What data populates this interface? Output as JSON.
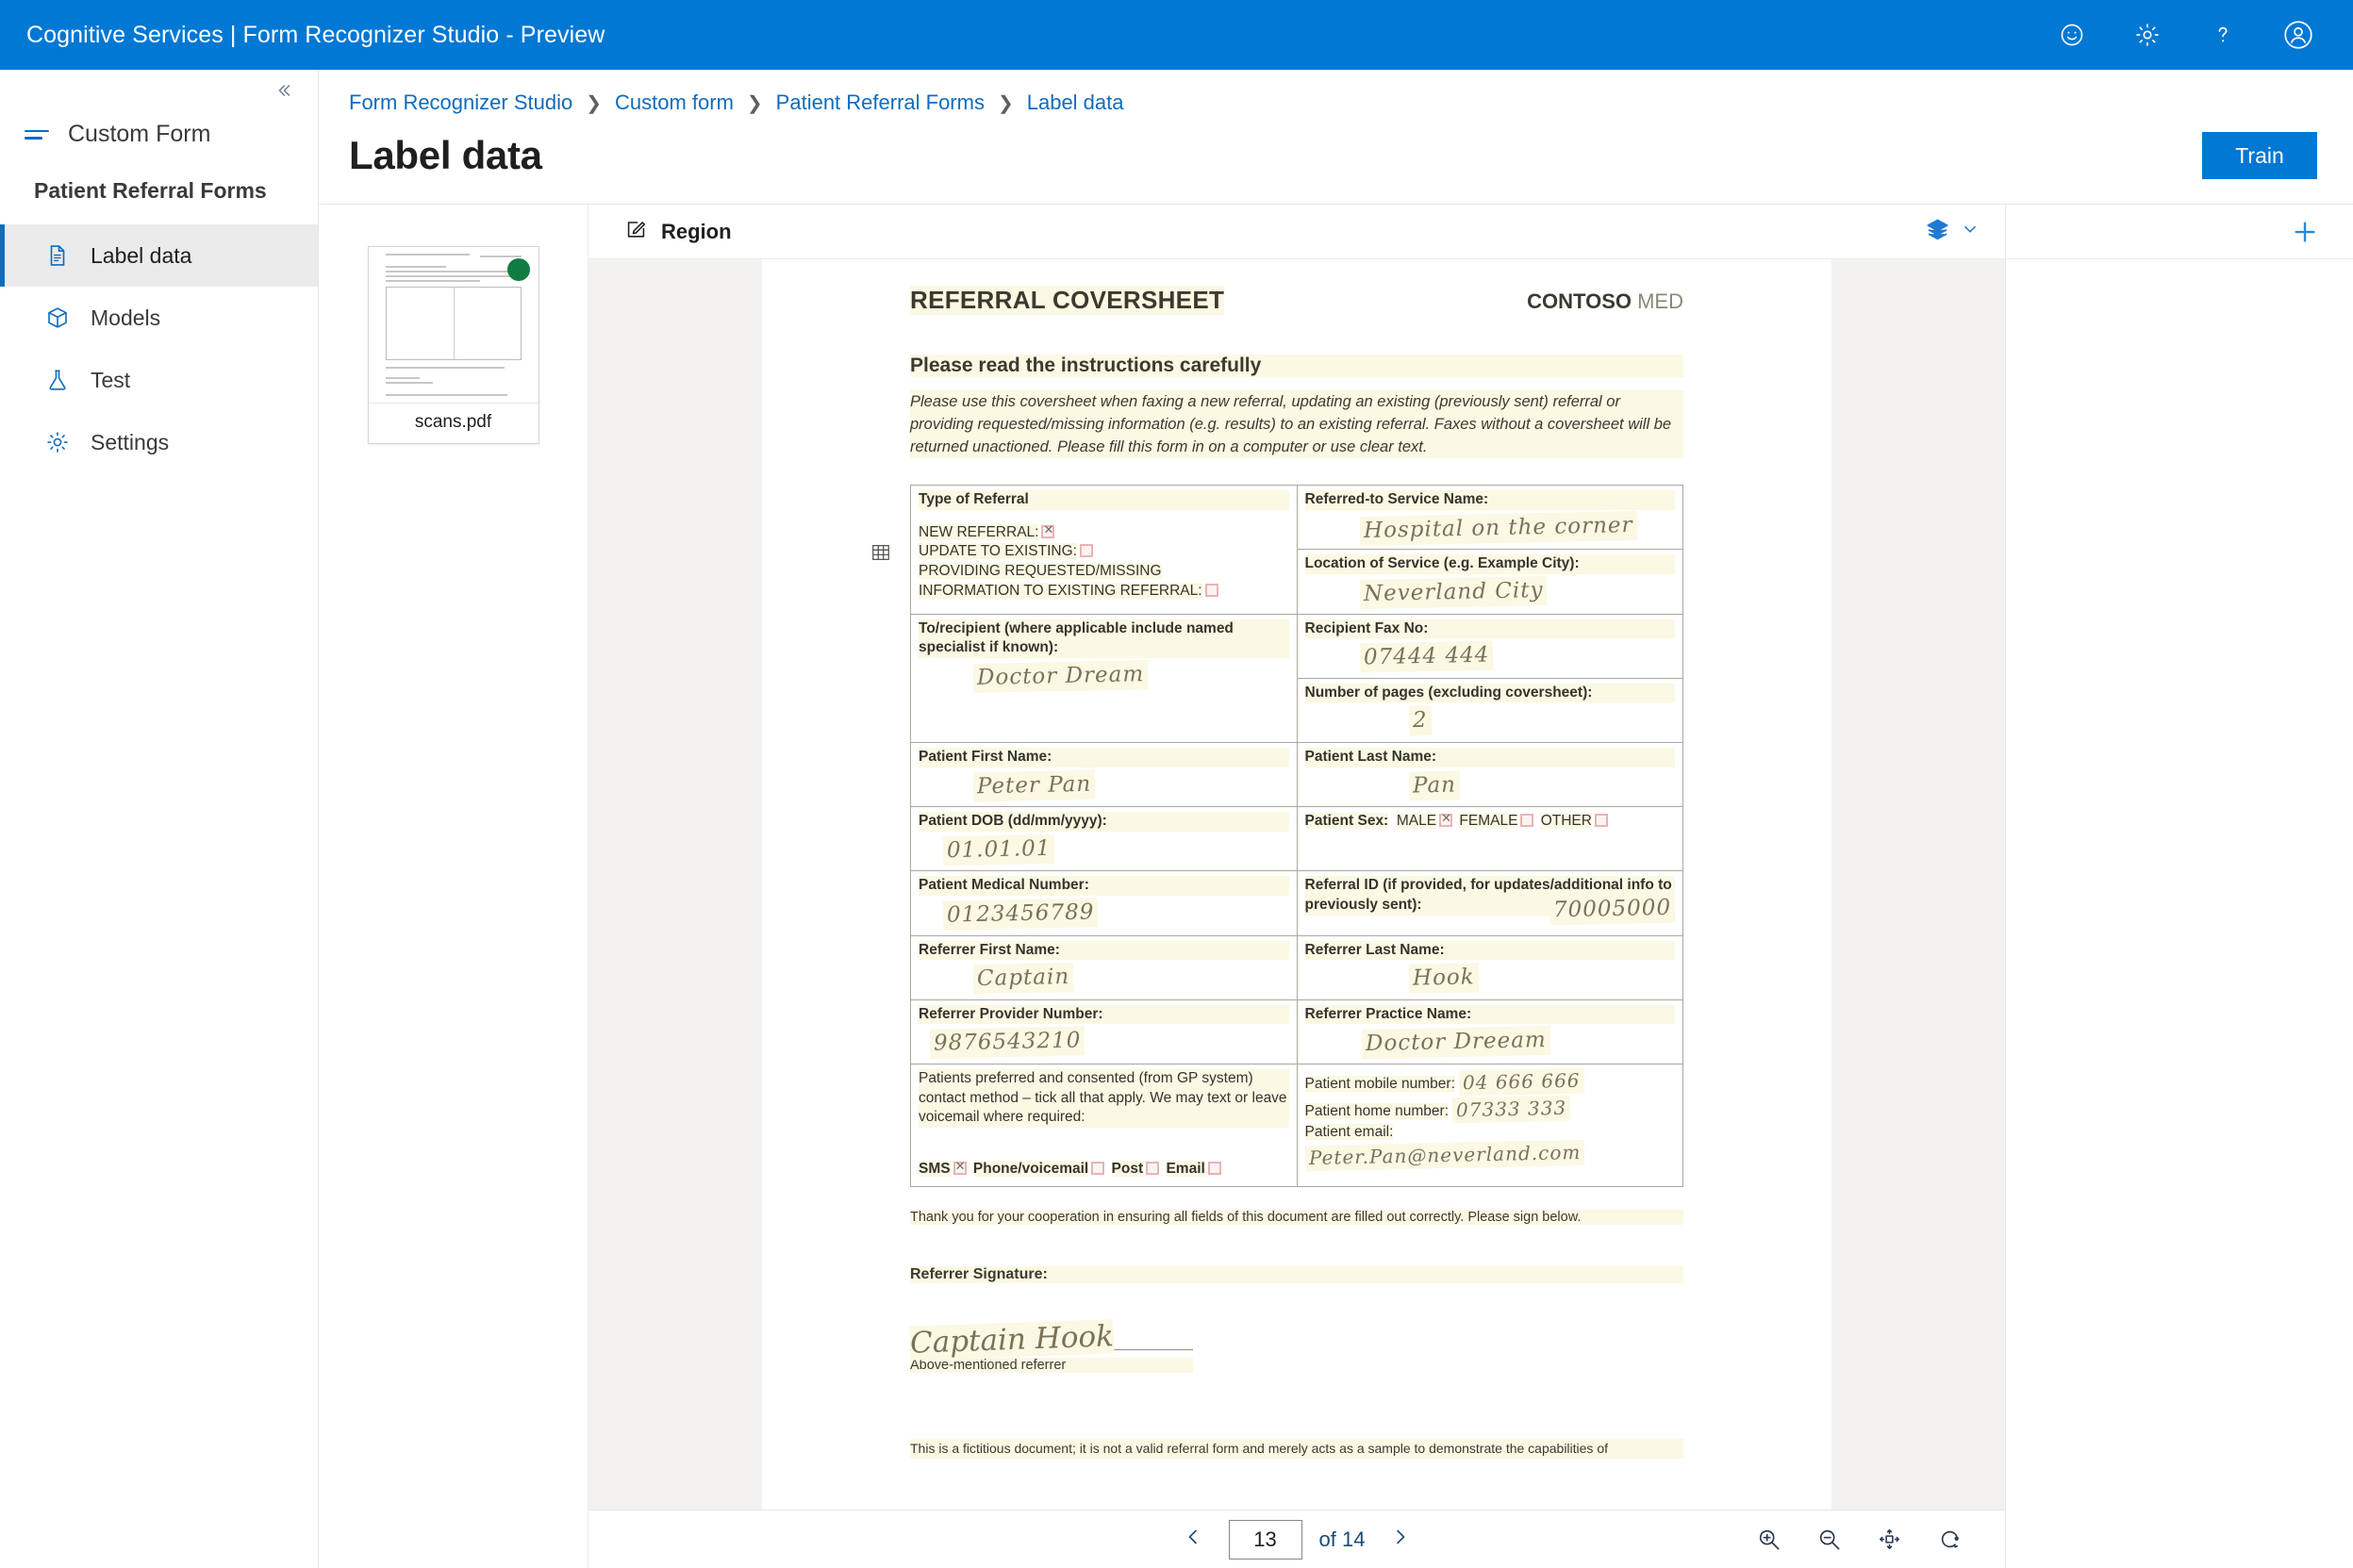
{
  "topbar": {
    "title": "Cognitive Services | Form Recognizer Studio - Preview",
    "icons": [
      {
        "name": "feedback-smiley-icon",
        "label": "Feedback"
      },
      {
        "name": "settings-gear-icon",
        "label": "Settings"
      },
      {
        "name": "help-question-icon",
        "label": "Help"
      },
      {
        "name": "account-avatar-icon",
        "label": "Account"
      }
    ]
  },
  "sidebar": {
    "collapse_label": "«",
    "menu_label": "Custom Form",
    "project_title": "Patient Referral Forms",
    "items": [
      {
        "label": "Label data",
        "icon": "document-icon",
        "active": true
      },
      {
        "label": "Models",
        "icon": "cube-icon",
        "active": false
      },
      {
        "label": "Test",
        "icon": "flask-icon",
        "active": false
      },
      {
        "label": "Settings",
        "icon": "gear-icon",
        "active": false
      }
    ]
  },
  "breadcrumb": [
    {
      "label": "Form Recognizer Studio"
    },
    {
      "label": "Custom form"
    },
    {
      "label": "Patient Referral Forms"
    },
    {
      "label": "Label data"
    }
  ],
  "header": {
    "page_title": "Label data",
    "train_label": "Train"
  },
  "thumbnails": [
    {
      "name": "scans.pdf",
      "status_color": "#107C41"
    }
  ],
  "viewer": {
    "tool_label": "Region",
    "tool_icon": "draw-region-icon",
    "layers_icon": "layers-icon",
    "chevron_icon": "chevron-down-icon",
    "page_value": "13",
    "page_total": "of 14",
    "prev_icon": "chevron-left-icon",
    "next_icon": "chevron-right-icon",
    "zoom_tools": [
      {
        "name": "zoom-in-icon"
      },
      {
        "name": "zoom-out-icon"
      },
      {
        "name": "fit-to-screen-icon"
      },
      {
        "name": "rotate-icon"
      }
    ]
  },
  "label_pane": {
    "add_icon": "plus-icon"
  },
  "document": {
    "title": "REFERRAL COVERSHEET",
    "brand_bold": "CONTOSO",
    "brand_light": "MED",
    "subtitle": "Please read the instructions carefully",
    "intro": "Please use this coversheet when faxing a new referral, updating an existing (previously sent) referral or providing requested/missing information (e.g. results) to an existing referral. Faxes without a coversheet will be returned unactioned. Please fill this form in on a computer or use clear text.",
    "rows": [
      {
        "left_label": "Type of Referral",
        "left_options": [
          {
            "text": "NEW REFERRAL:",
            "checked": true
          },
          {
            "text": "UPDATE TO EXISTING:",
            "checked": false
          },
          {
            "text": "PROVIDING REQUESTED/MISSING",
            "checked": null
          },
          {
            "text": "INFORMATION TO EXISTING REFERRAL:",
            "checked": false
          }
        ],
        "right_label": "Referred-to Service Name:",
        "right_value": "Hospital on the corner",
        "right_label2": "Location of Service (e.g. Example City):",
        "right_value2": "Neverland City"
      },
      {
        "left_label": "To/recipient (where applicable include named specialist if known):",
        "left_value": "Doctor Dream",
        "right_label": "Recipient Fax No:",
        "right_value": "07444 444",
        "right_label2": "Number of pages (excluding coversheet):",
        "right_value2": "2"
      },
      {
        "left_label": "Patient First Name:",
        "left_value": "Peter Pan",
        "right_label": "Patient Last Name:",
        "right_value": "Pan"
      },
      {
        "left_label": "Patient DOB (dd/mm/yyyy):",
        "left_value": "01.01.01",
        "right_label": "Patient Sex:",
        "right_options": [
          {
            "text": "MALE",
            "checked": true
          },
          {
            "text": "FEMALE",
            "checked": false
          },
          {
            "text": "OTHER",
            "checked": false
          }
        ]
      },
      {
        "left_label": "Patient Medical Number:",
        "left_value": "0123456789",
        "right_label": "Referral ID (if provided, for updates/additional info to previously sent):",
        "right_value": "70005000"
      },
      {
        "left_label": "Referrer First Name:",
        "left_value": "Captain",
        "right_label": "Referrer Last Name:",
        "right_value": "Hook"
      },
      {
        "left_label": "Referrer Provider Number:",
        "left_value": "9876543210",
        "right_label": "Referrer Practice Name:",
        "right_value": "Doctor Dreeam"
      },
      {
        "left_label": "Patients preferred and consented (from GP system) contact method – tick all that apply. We may text or leave voicemail where required:",
        "left_options": [
          {
            "text": "SMS",
            "checked": true
          },
          {
            "text": "Phone/voicemail",
            "checked": false
          },
          {
            "text": "Post",
            "checked": false
          },
          {
            "text": "Email",
            "checked": false
          }
        ],
        "right_contacts": [
          {
            "label": "Patient mobile number:",
            "value": "04 666 666"
          },
          {
            "label": "Patient home number:",
            "value": "07333 333"
          },
          {
            "label": "Patient email:",
            "value": "Peter.Pan@neverland.com"
          }
        ]
      }
    ],
    "thanks": "Thank you for your cooperation in ensuring all fields of this document are filled out correctly. Please sign below.",
    "signature_label": "Referrer Signature:",
    "signature_value": "Captain Hook",
    "signature_note": "Above-mentioned referrer",
    "disclaimer": "This is a fictitious document; it is not a valid referral form and merely acts as a sample to demonstrate the capabilities of"
  }
}
